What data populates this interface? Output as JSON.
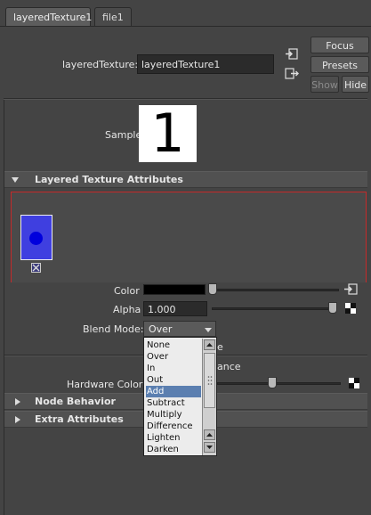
{
  "tabs": [
    {
      "label": "layeredTexture1",
      "active": true
    },
    {
      "label": "file1",
      "active": false
    }
  ],
  "header": {
    "node_label": "layeredTexture:",
    "node_value": "layeredTexture1",
    "buttons": {
      "focus": "Focus",
      "presets": "Presets",
      "show": "Show",
      "hide": "Hide"
    }
  },
  "sample": {
    "label": "Sample",
    "swatch_text": "1"
  },
  "sections": {
    "layered": "Layered Texture Attributes",
    "node_behavior": "Node Behavior",
    "extra": "Extra Attributes"
  },
  "layer": {
    "swatch_color": "#3f3fe0",
    "dot_color": "#0000dd",
    "border_color": "#c52a2a"
  },
  "attrs": {
    "color_label": "Color",
    "alpha_label": "Alpha",
    "alpha_value": "1.000",
    "blend_label": "Blend Mode:",
    "blend_value": "Over",
    "hidden_fragment_1": "e",
    "hidden_fragment_2": "ance",
    "hw_color_label": "Hardware Color"
  },
  "blend_options": [
    "None",
    "Over",
    "In",
    "Out",
    "Add",
    "Subtract",
    "Multiply",
    "Difference",
    "Lighten",
    "Darken"
  ],
  "blend_highlighted": "Add",
  "icons": [
    "map-input-icon",
    "map-output-icon",
    "texture-map-icon",
    "checker-icon",
    "layer-remove-icon",
    "dropdown-arrow-icon"
  ]
}
